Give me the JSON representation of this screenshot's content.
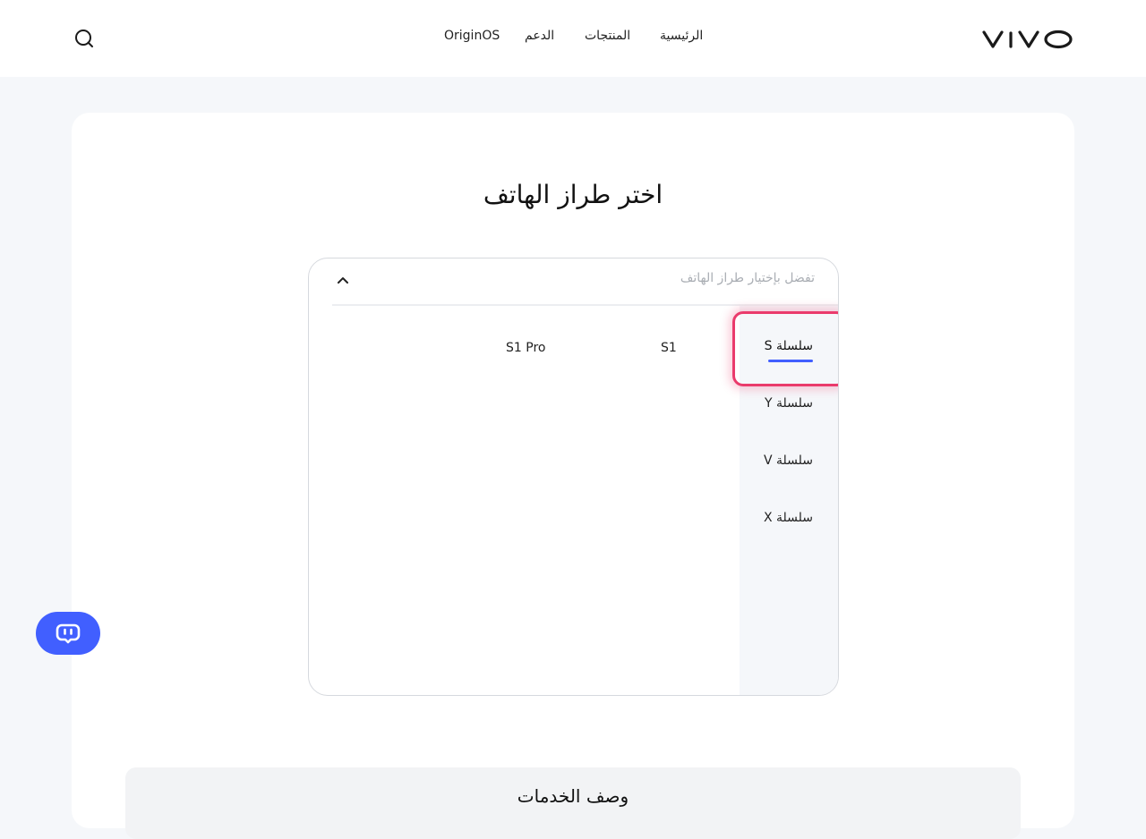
{
  "header": {
    "logo_text": "vivo",
    "nav": [
      {
        "label": "الرئيسية"
      },
      {
        "label": "المنتجات"
      },
      {
        "label": "الدعم"
      },
      {
        "label": "OriginOS"
      }
    ]
  },
  "page": {
    "title": "اختر طراز الهاتف"
  },
  "selector": {
    "placeholder": "تفضل بإختيار طراز الهاتف",
    "series": [
      {
        "label": "S سلسلة",
        "active": true
      },
      {
        "label": "Y سلسلة",
        "active": false
      },
      {
        "label": "V سلسلة",
        "active": false
      },
      {
        "label": "X سلسلة",
        "active": false
      }
    ],
    "models": [
      {
        "label": "S1"
      },
      {
        "label": "S1 Pro"
      }
    ]
  },
  "services": {
    "title": "وصف الخدمات"
  },
  "colors": {
    "accent": "#415fff",
    "focus": "#ea3b6c",
    "background": "#f5f7fa"
  },
  "icons": {
    "search": "search-icon",
    "chevron": "chevron-up-icon",
    "bot": "chat-bot-icon"
  }
}
